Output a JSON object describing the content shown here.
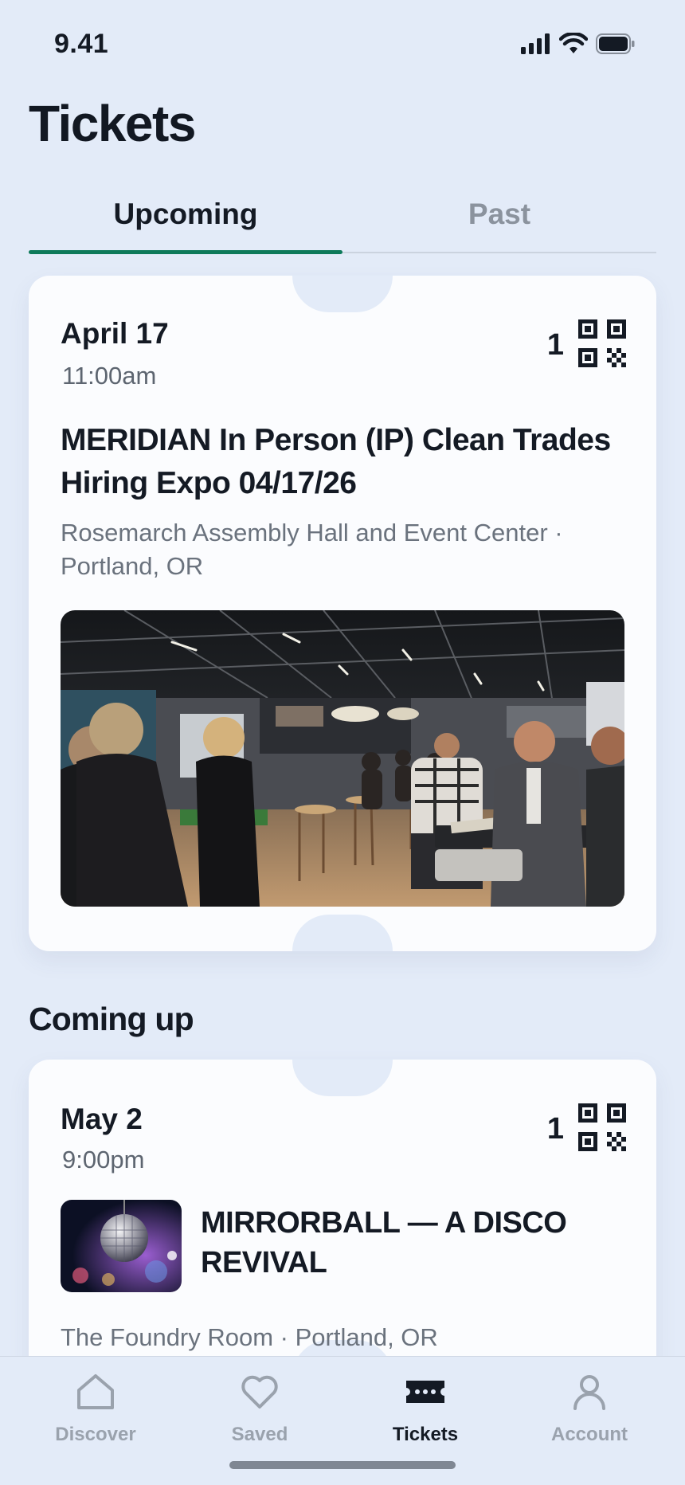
{
  "status_bar": {
    "time": "9.41"
  },
  "page_title": "Tickets",
  "tabs": [
    {
      "label": "Upcoming",
      "active": true
    },
    {
      "label": "Past",
      "active": false
    }
  ],
  "featured_ticket": {
    "date": "April 17",
    "time": "11:00am",
    "ticket_count": "1",
    "title": "MERIDIAN In Person (IP) Clean Trades Hiring Expo  04/17/26",
    "venue": "Rosemarch Assembly Hall and Event Center · Portland, OR"
  },
  "coming_up": {
    "heading": "Coming up",
    "tickets": [
      {
        "date": "May 2",
        "time": "9:00pm",
        "ticket_count": "1",
        "title": "MIRRORBALL — A DISCO REVIVAL",
        "venue": "The Foundry Room · Portland, OR"
      }
    ]
  },
  "bottom_nav": {
    "items": [
      {
        "label": "Discover",
        "icon": "home-icon",
        "active": false
      },
      {
        "label": "Saved",
        "icon": "heart-icon",
        "active": false
      },
      {
        "label": "Tickets",
        "icon": "ticket-icon",
        "active": true
      },
      {
        "label": "Account",
        "icon": "person-icon",
        "active": false
      }
    ]
  },
  "colors": {
    "background": "#e3ebf8",
    "card": "#fbfcfe",
    "accent": "#0e7a5a",
    "text_primary": "#141a24",
    "text_secondary": "#6a727d",
    "nav_inactive": "#9aa2ad"
  }
}
